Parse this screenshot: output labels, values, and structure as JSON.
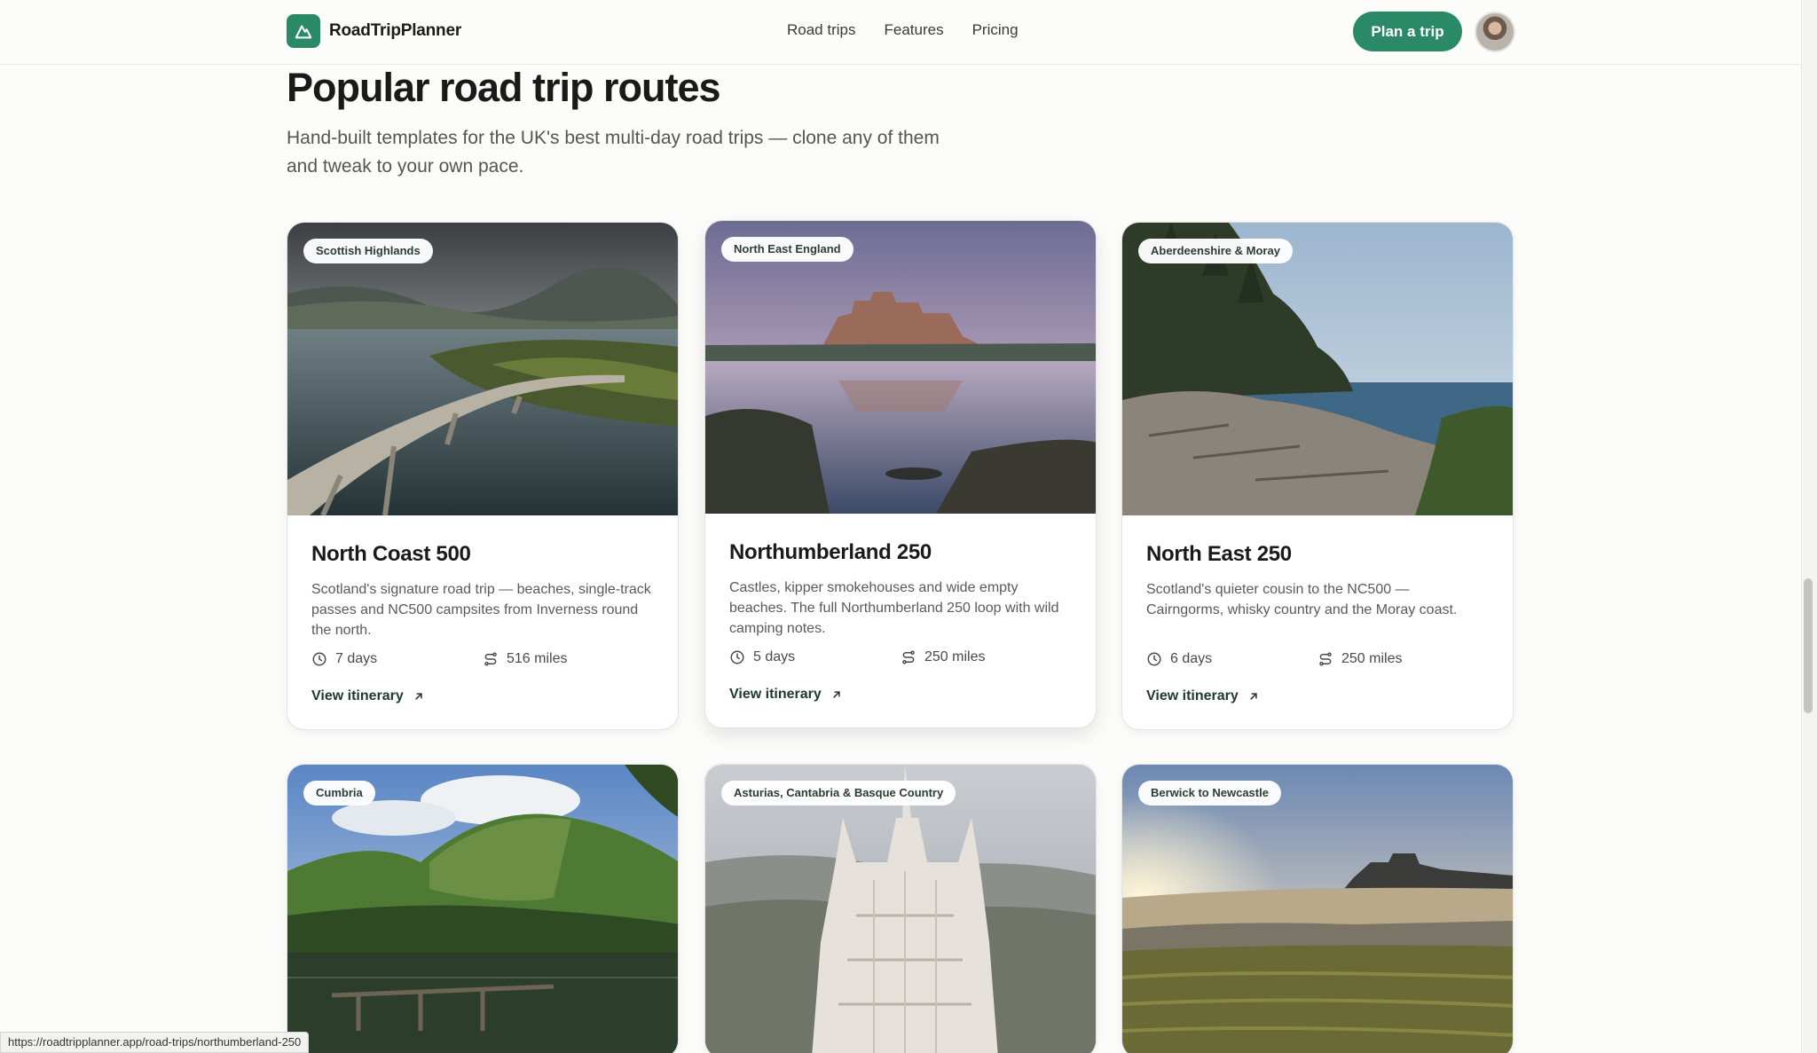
{
  "brand": {
    "name": "RoadTripPlanner"
  },
  "nav": {
    "items": [
      "Road trips",
      "Features",
      "Pricing"
    ]
  },
  "header": {
    "cta_label": "Plan a trip"
  },
  "intro": {
    "title": "Popular road trip routes",
    "subtitle": "Hand-built templates for the UK's best multi-day road trips — clone any of them and tweak to your own pace."
  },
  "cards": [
    {
      "region": "Scottish Highlands",
      "title": "North Coast 500",
      "description": "Scotland's signature road trip — beaches, single-track passes and NC500 campsites from Inverness round the north.",
      "days": "7 days",
      "distance": "516 miles",
      "link_label": "View itinerary"
    },
    {
      "region": "North East England",
      "title": "Northumberland 250",
      "description": "Castles, kipper smokehouses and wide empty beaches. The full Northumberland 250 loop with wild camping notes.",
      "days": "5 days",
      "distance": "250 miles",
      "link_label": "View itinerary"
    },
    {
      "region": "Aberdeenshire & Moray",
      "title": "North East 250",
      "description": "Scotland's quieter cousin to the NC500 — Cairngorms, whisky country and the Moray coast.",
      "days": "6 days",
      "distance": "250 miles",
      "link_label": "View itinerary"
    },
    {
      "region": "Cumbria"
    },
    {
      "region": "Asturias, Cantabria & Basque Country"
    },
    {
      "region": "Berwick to Newcastle"
    }
  ],
  "status_bar": {
    "url": "https://roadtripplanner.app/road-trips/northumberland-250"
  },
  "colors": {
    "accent": "#2a8a68",
    "link": "#1e3a2c"
  }
}
